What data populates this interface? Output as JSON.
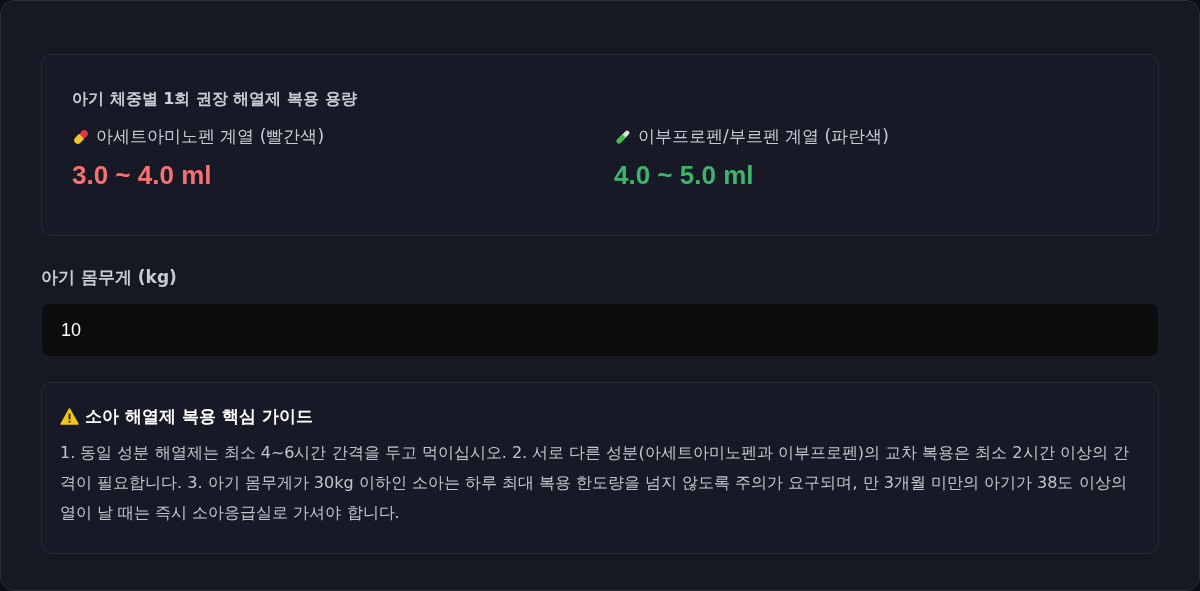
{
  "dosage_card": {
    "title": "아기 체중별 1회 권장 해열제 복용 용량",
    "medicines": [
      {
        "kind": "pill",
        "label": "아세트아미노펜 계열 (빨간색)",
        "dose": "3.0 ~ 4.0 ml",
        "color": "#f87171"
      },
      {
        "kind": "tube",
        "label": "이부프로펜/부르펜 계열 (파란색)",
        "dose": "4.0 ~ 5.0 ml",
        "color": "#3fb46e"
      }
    ]
  },
  "weight_field": {
    "label": "아기 몸무게 (kg)",
    "value": "10"
  },
  "guide": {
    "title": "소아 해열제 복용 핵심 가이드",
    "text": "1. 동일 성분 해열제는 최소 4~6시간 간격을 두고 먹이십시오. 2. 서로 다른 성분(아세트아미노펜과 이부프로펜)의 교차 복용은 최소 2시간 이상의 간격이 필요합니다. 3. 아기 몸무게가 30kg 이하인 소아는 하루 최대 복용 한도량을 넘지 않도록 주의가 요구되며, 만 3개월 미만의 아기가 38도 이상의 열이 날 때는 즉시 소아응급실로 가셔야 합니다."
  }
}
